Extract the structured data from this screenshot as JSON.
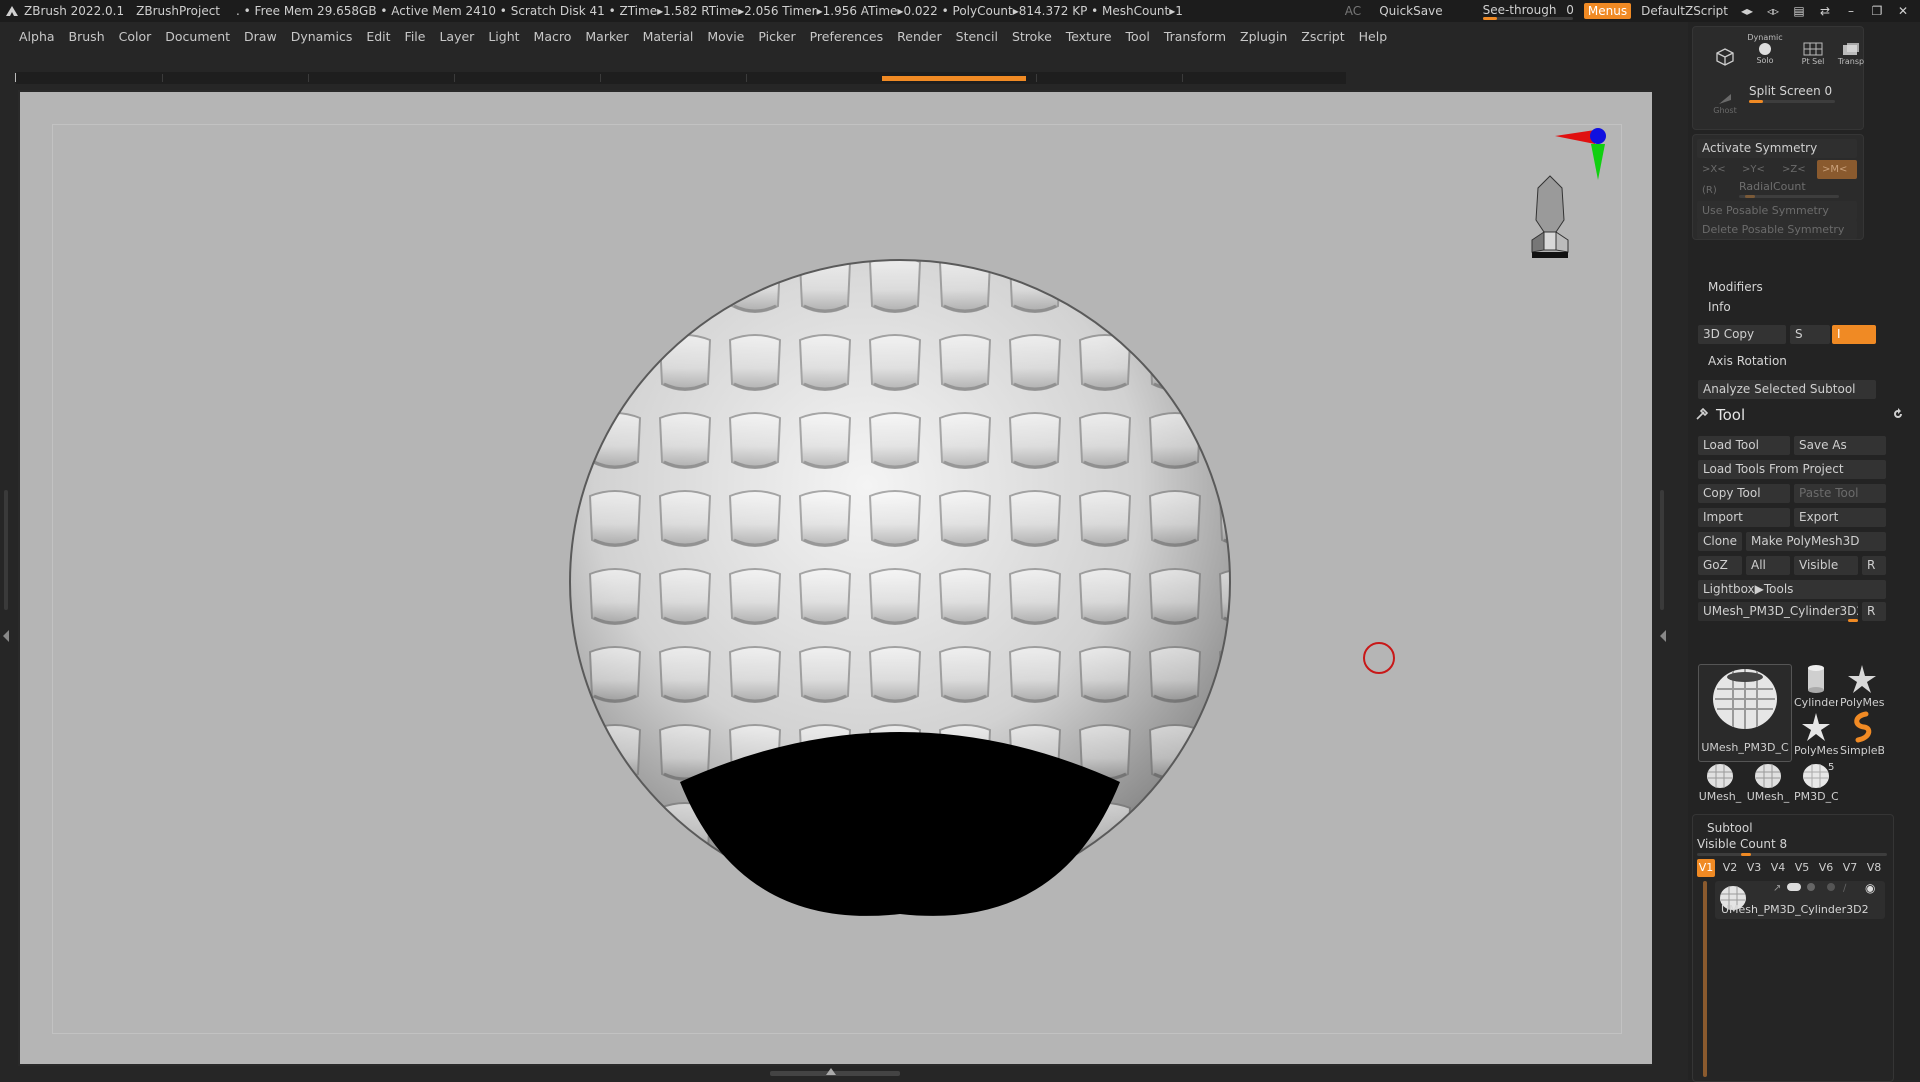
{
  "titlebar": {
    "app": "ZBrush 2022.0.1",
    "project": "ZBrushProject",
    "status": ". • Free Mem 29.658GB • Active Mem 2410 • Scratch Disk 41 • ZTime▸1.582 RTime▸2.056 Timer▸1.956 ATime▸0.022 • PolyCount▸814.372 KP • MeshCount▸1",
    "ac": "AC",
    "quicksave": "QuickSave",
    "seethrough_label": "See-through",
    "seethrough_value": "0",
    "seethrough_level": 0,
    "menus": "Menus",
    "script": "DefaultZScript"
  },
  "menubar": [
    "Alpha",
    "Brush",
    "Color",
    "Document",
    "Draw",
    "Dynamics",
    "Edit",
    "File",
    "Layer",
    "Light",
    "Macro",
    "Marker",
    "Material",
    "Movie",
    "Picker",
    "Preferences",
    "Render",
    "Stencil",
    "Stroke",
    "Texture",
    "Tool",
    "Transform",
    "Zplugin",
    "Zscript",
    "Help"
  ],
  "tray": {
    "top_icons": {
      "dynamic": "Dynamic",
      "solo": "Solo",
      "ptsel": "Pt Sel",
      "transp": "Transp",
      "ghost": "Ghost"
    },
    "split_screen": "Split Screen 0",
    "activate_symmetry": "Activate Symmetry",
    "sym_x": ">X<",
    "sym_y": ">Y<",
    "sym_z": ">Z<",
    "sym_m": ">M<",
    "radial_r": "(R)",
    "radial_count": "RadialCount",
    "use_posable": "Use Posable Symmetry",
    "delete_posable": "Delete Posable Symmetry",
    "modifiers": "Modifiers",
    "info": "Info",
    "copy3d": "3D Copy",
    "copy3d_s": "S",
    "copy3d_value": "I",
    "axis_rotation": "Axis Rotation",
    "analyze": "Analyze Selected Subtool",
    "tool_title": "Tool",
    "load_tool": "Load Tool",
    "save_as": "Save As",
    "load_from_project": "Load Tools From Project",
    "copy_tool": "Copy Tool",
    "paste_tool": "Paste Tool",
    "import": "Import",
    "export": "Export",
    "clone": "Clone",
    "make_polymesh": "Make PolyMesh3D",
    "goz": "GoZ",
    "all": "All",
    "visible": "Visible",
    "r": "R",
    "lightbox_tools": "Lightbox▶Tools",
    "current_tool": "UMesh_PM3D_Cylinder3D2.",
    "thumbs": {
      "main": "UMesh_PM3D_C",
      "cylinder": "Cylinder",
      "polymesh1": "PolyMes",
      "polymesh2": "PolyMes",
      "simpleb": "SimpleB",
      "umesh1": "UMesh_",
      "umesh2": "UMesh_",
      "pm3d": "PM3D_C",
      "pm3d_count": "5"
    },
    "subtool": "Subtool",
    "visible_count": "Visible Count 8",
    "vtabs": [
      "V1",
      "V2",
      "V3",
      "V4",
      "V5",
      "V6",
      "V7",
      "V8"
    ],
    "subtool_name": "UMesh_PM3D_Cylinder3D2"
  },
  "colors": {
    "accent": "#f08a24",
    "canvas": "#b5b5b5",
    "panel": "#232323"
  }
}
